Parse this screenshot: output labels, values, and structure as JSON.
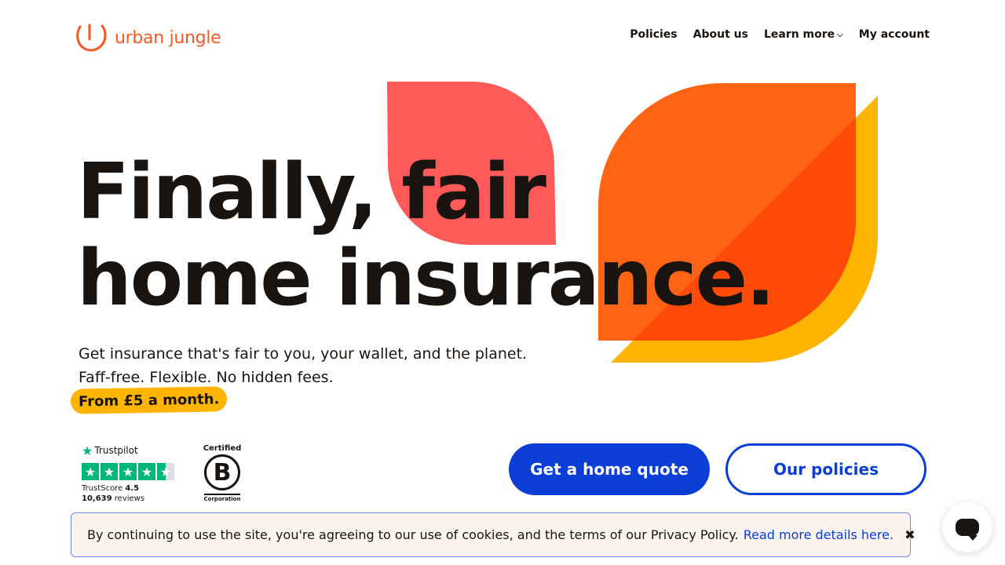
{
  "brand": {
    "name": "urban jungle",
    "accent_color": "#f15a24",
    "primary_blue": "#0a3ed6"
  },
  "nav": {
    "items": [
      {
        "label": "Policies"
      },
      {
        "label": "About us"
      },
      {
        "label": "Learn more",
        "icon": "chevron-down-icon"
      },
      {
        "label": "My account"
      }
    ]
  },
  "hero": {
    "headline_line1": "Finally, fair",
    "headline_line2": "home insurance.",
    "sub_line1": "Get insurance that's fair to you, your wallet, and the planet.",
    "sub_line2": "Faff-free. Flexible. No hidden fees.",
    "price_pill": "From £5 a month."
  },
  "trustpilot": {
    "name": "Trustpilot",
    "score_label": "TrustScore",
    "score": "4.5",
    "reviews_count": "10,639",
    "reviews_label": "reviews",
    "stars": 4.5
  },
  "bcorp": {
    "certified": "Certified",
    "letter": "B",
    "corporation": "Corporation"
  },
  "cta": {
    "primary": "Get a home quote",
    "secondary": "Our policies"
  },
  "cookie": {
    "text": "By continuing to use the site, you're agreeing to our use of cookies, and the terms of our Privacy Policy.",
    "link": "Read more details here.",
    "close": "✖"
  },
  "colors": {
    "leaf_pink": "#ff5a5a",
    "leaf_orange": "#ff6414",
    "leaf_yellow": "#ffb400"
  }
}
